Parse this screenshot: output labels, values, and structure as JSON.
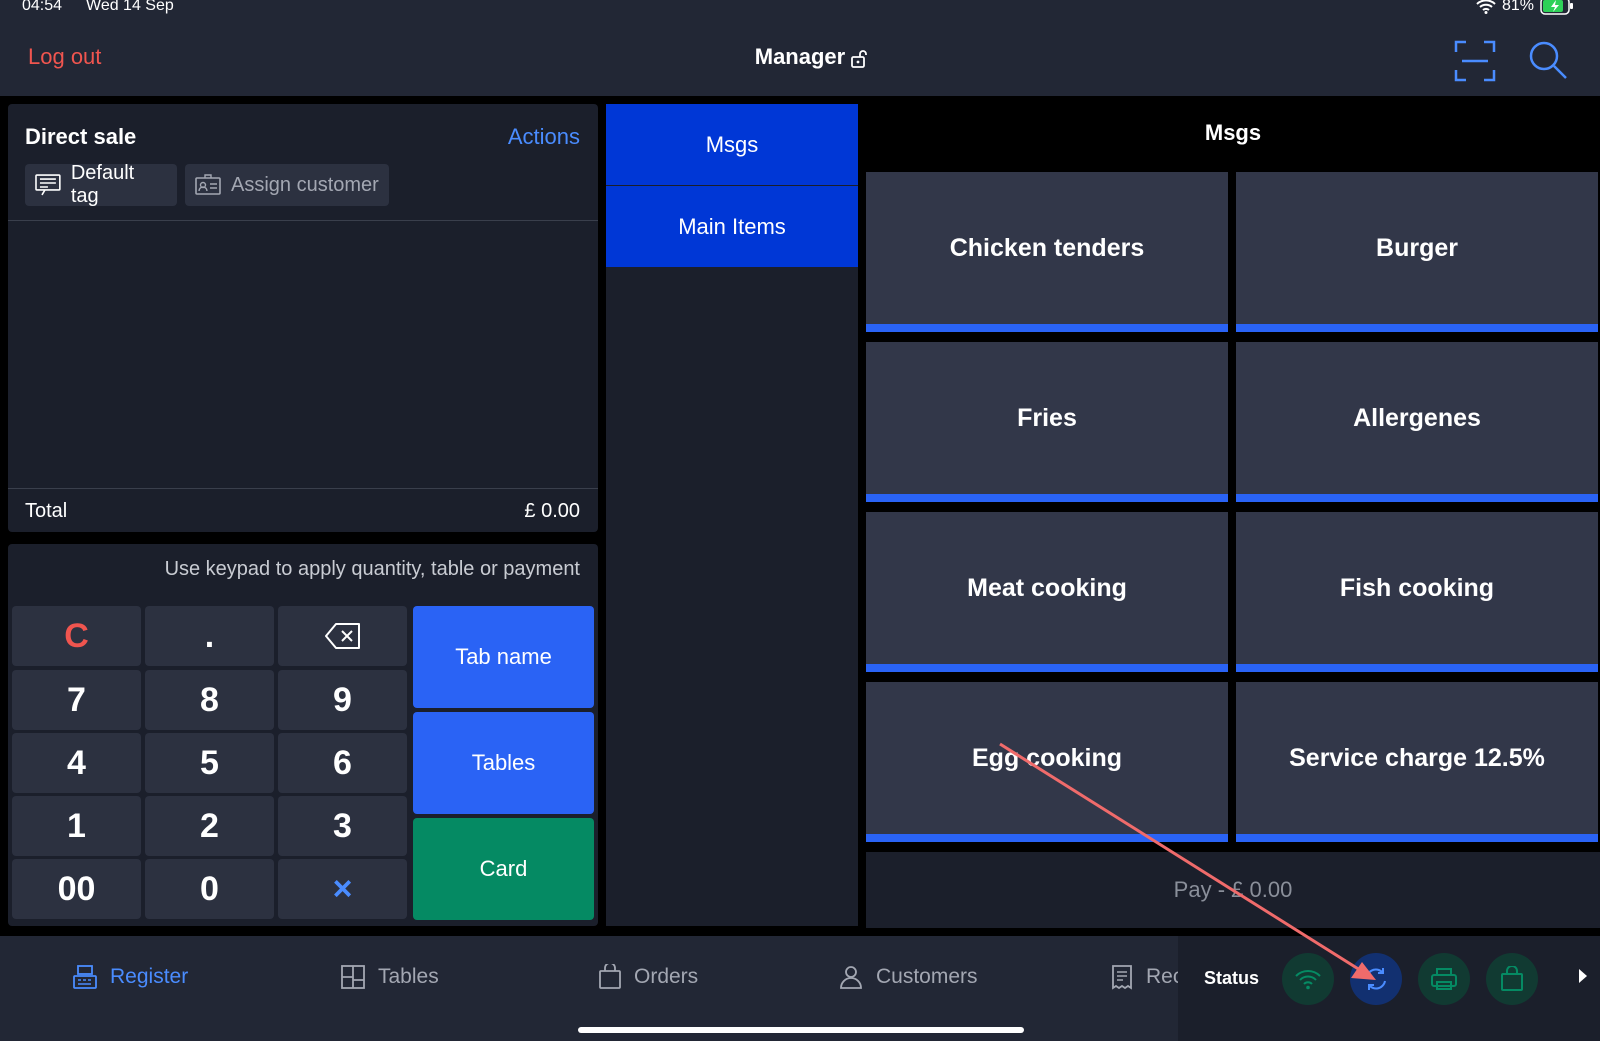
{
  "status_bar": {
    "time": "04:54",
    "date": "Wed 14 Sep",
    "battery": "81%"
  },
  "header": {
    "logout_label": "Log out",
    "title": "Manager"
  },
  "order": {
    "title": "Direct sale",
    "actions_label": "Actions",
    "default_tag_label": "Default tag",
    "assign_customer_label": "Assign customer",
    "total_label": "Total",
    "total_value": "£ 0.00"
  },
  "keypad": {
    "hint": "Use keypad to apply quantity, table or payment",
    "keys": {
      "clear": "C",
      "dot": ".",
      "k7": "7",
      "k8": "8",
      "k9": "9",
      "k4": "4",
      "k5": "5",
      "k6": "6",
      "k1": "1",
      "k2": "2",
      "k3": "3",
      "k00": "00",
      "k0": "0",
      "multiply": "×"
    },
    "tab_name_label": "Tab name",
    "tables_label": "Tables",
    "card_label": "Card"
  },
  "categories": [
    {
      "label": "Msgs"
    },
    {
      "label": "Main Items"
    }
  ],
  "grid": {
    "title": "Msgs",
    "items": [
      {
        "label": "Chicken tenders"
      },
      {
        "label": "Burger"
      },
      {
        "label": "Fries"
      },
      {
        "label": "Allergenes"
      },
      {
        "label": "Meat cooking"
      },
      {
        "label": "Fish cooking"
      },
      {
        "label": "Egg cooking"
      },
      {
        "label": "Service charge 12.5%"
      }
    ],
    "pay_label": "Pay - £ 0.00"
  },
  "tabs": [
    {
      "label": "Register",
      "icon": "register-icon",
      "active": true
    },
    {
      "label": "Tables",
      "icon": "tables-icon"
    },
    {
      "label": "Orders",
      "icon": "bag-icon"
    },
    {
      "label": "Customers",
      "icon": "person-icon"
    },
    {
      "label": "Rec",
      "icon": "receipt-icon"
    }
  ],
  "status_panel": {
    "label": "Status"
  },
  "colors": {
    "accent_blue": "#2a63f5",
    "category_blue": "#0037d6",
    "card_green": "#058a63",
    "logout_red": "#f0554f"
  }
}
